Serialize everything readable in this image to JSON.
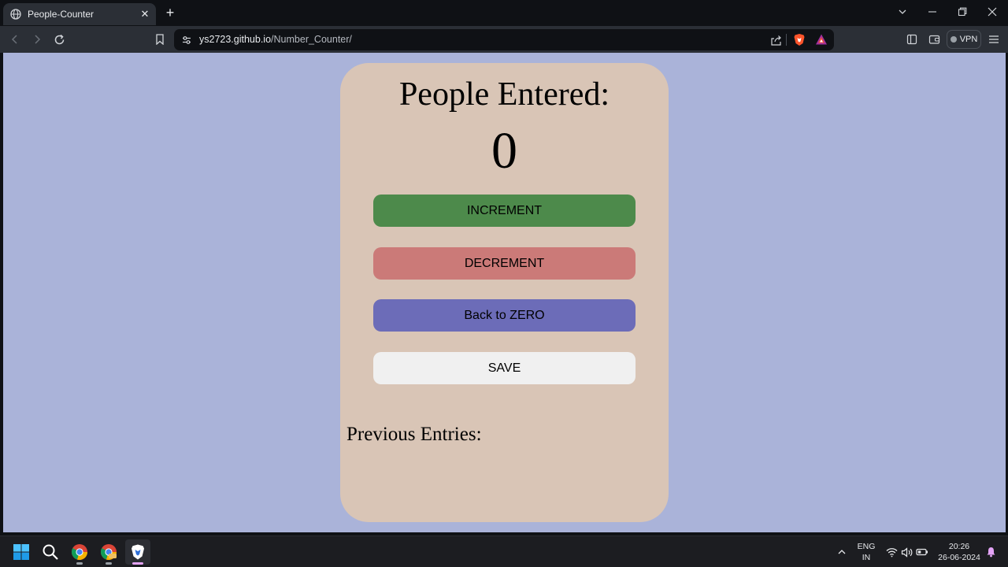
{
  "browser": {
    "tab_title": "People-Counter",
    "tab_close": "✕",
    "new_tab": "+",
    "url_host": "ys2723.github.io",
    "url_path": "/Number_Counter/",
    "vpn_label": "VPN"
  },
  "page": {
    "heading": "People Entered:",
    "count": "0",
    "buttons": {
      "increment": "INCREMENT",
      "decrement": "DECREMENT",
      "reset": "Back to ZERO",
      "save": "SAVE"
    },
    "previous_entries_label": "Previous Entries:"
  },
  "colors": {
    "page_background": "#aab3d9",
    "card_background": "#d9c5b6",
    "increment": "#4d8a4b",
    "decrement": "#cb7a78",
    "reset": "#6c6cb8",
    "save": "#f0f0f0"
  },
  "taskbar": {
    "apps": [
      "windows-start-icon",
      "search-icon",
      "chrome-icon",
      "chrome-beta-icon",
      "brave-icon"
    ],
    "language": "ENG",
    "region": "IN",
    "time": "20:26",
    "date": "26-06-2024"
  }
}
